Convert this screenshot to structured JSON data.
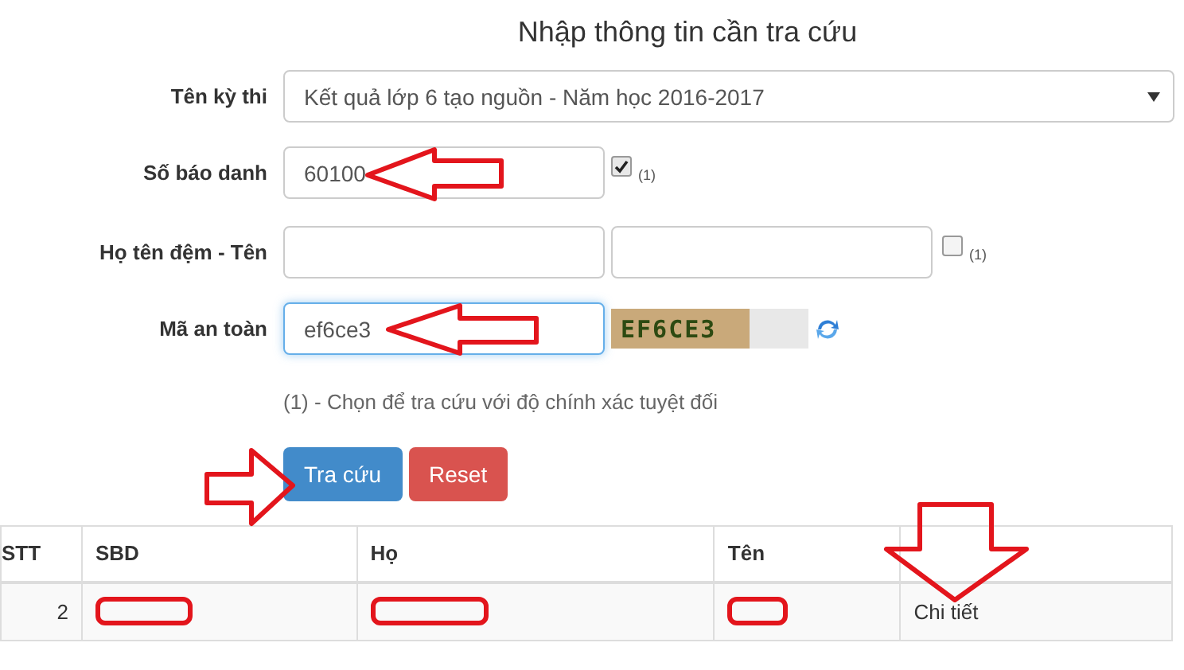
{
  "title": "Nhập thông tin cần tra cứu",
  "form": {
    "exam": {
      "label": "Tên kỳ thi",
      "value": "Kết quả lớp 6 tạo nguồn - Năm học 2016-2017"
    },
    "candidate_number": {
      "label": "Số báo danh",
      "value": "60100",
      "exact": {
        "checked": true,
        "note": "(1)"
      }
    },
    "name": {
      "label": "Họ tên đệm - Tên",
      "exact": {
        "checked": false,
        "note": "(1)"
      }
    },
    "captcha": {
      "label": "Mã an toàn",
      "value": "ef6ce3",
      "code": "EF6CE3"
    },
    "note": "(1) - Chọn để tra cứu với độ chính xác tuyệt đối",
    "buttons": [
      {
        "label": "Tra cứu",
        "kind": "primary"
      },
      {
        "label": "Reset",
        "kind": "danger"
      }
    ]
  },
  "table": {
    "columns": [
      "STT",
      "SBD",
      "Họ",
      "Tên"
    ],
    "rows": [
      {
        "stt": "2",
        "link": "Chi tiết"
      }
    ]
  }
}
